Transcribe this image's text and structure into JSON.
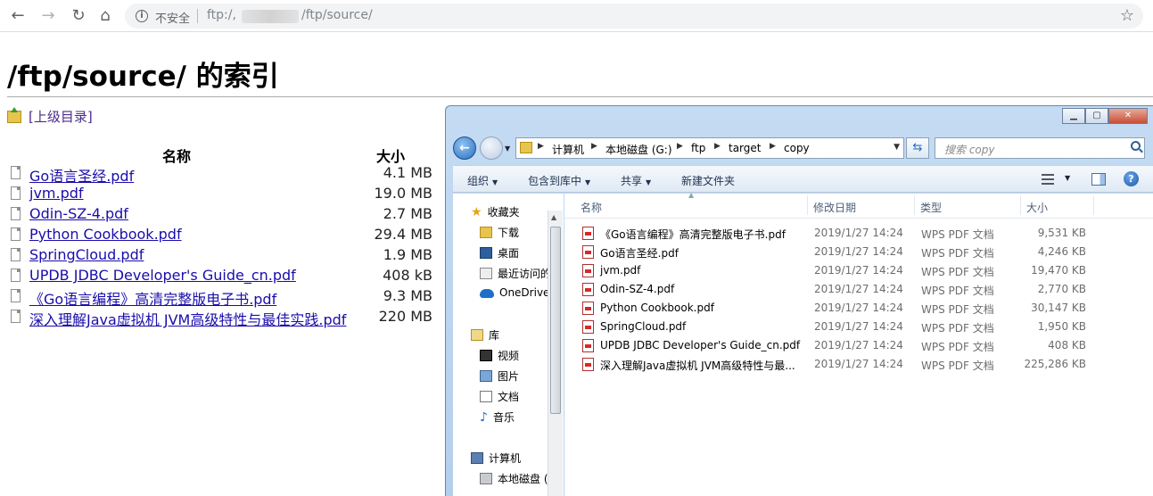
{
  "browser": {
    "security_label": "不安全",
    "url_prefix": "ftp:/,",
    "url_path": "/ftp/source/"
  },
  "page": {
    "title": "/ftp/source/ 的索引",
    "parent_link": "[上级目录]",
    "col_name": "名称",
    "col_size": "大小",
    "files": [
      {
        "name": "Go语言圣经.pdf",
        "size": "4.1 MB"
      },
      {
        "name": "jvm.pdf",
        "size": "19.0 MB"
      },
      {
        "name": "Odin-SZ-4.pdf",
        "size": "2.7 MB"
      },
      {
        "name": "Python Cookbook.pdf",
        "size": "29.4 MB"
      },
      {
        "name": "SpringCloud.pdf",
        "size": "1.9 MB"
      },
      {
        "name": "UPDB JDBC Developer's Guide_cn.pdf",
        "size": "408 kB"
      },
      {
        "name": "《Go语言编程》高清完整版电子书.pdf",
        "size": "9.3 MB"
      },
      {
        "name": "深入理解Java虚拟机 JVM高级特性与最佳实践.pdf",
        "size": "220 MB"
      }
    ]
  },
  "explorer": {
    "breadcrumbs": [
      "计算机",
      "本地磁盘 (G:)",
      "ftp",
      "target",
      "copy"
    ],
    "search_placeholder": "搜索 copy",
    "toolbar": {
      "organize": "组织",
      "include_library": "包含到库中",
      "share": "共享",
      "new_folder": "新建文件夹"
    },
    "nav": {
      "favorites": "收藏夹",
      "downloads": "下载",
      "desktop": "桌面",
      "recent": "最近访问的",
      "onedrive": "OneDrive",
      "libraries": "库",
      "videos": "视频",
      "pictures": "图片",
      "documents": "文档",
      "music": "音乐",
      "computer": "计算机",
      "local_disk": "本地磁盘 ("
    },
    "columns": {
      "name": "名称",
      "date": "修改日期",
      "type": "类型",
      "size": "大小"
    },
    "files": [
      {
        "name": "《Go语言编程》高清完整版电子书.pdf",
        "date": "2019/1/27 14:24",
        "type": "WPS PDF 文档",
        "size": "9,531 KB"
      },
      {
        "name": "Go语言圣经.pdf",
        "date": "2019/1/27 14:24",
        "type": "WPS PDF 文档",
        "size": "4,246 KB"
      },
      {
        "name": "jvm.pdf",
        "date": "2019/1/27 14:24",
        "type": "WPS PDF 文档",
        "size": "19,470 KB"
      },
      {
        "name": "Odin-SZ-4.pdf",
        "date": "2019/1/27 14:24",
        "type": "WPS PDF 文档",
        "size": "2,770 KB"
      },
      {
        "name": "Python Cookbook.pdf",
        "date": "2019/1/27 14:24",
        "type": "WPS PDF 文档",
        "size": "30,147 KB"
      },
      {
        "name": "SpringCloud.pdf",
        "date": "2019/1/27 14:24",
        "type": "WPS PDF 文档",
        "size": "1,950 KB"
      },
      {
        "name": "UPDB JDBC Developer's Guide_cn.pdf",
        "date": "2019/1/27 14:24",
        "type": "WPS PDF 文档",
        "size": "408 KB"
      },
      {
        "name": "深入理解Java虚拟机 JVM高级特性与最...",
        "date": "2019/1/27 14:24",
        "type": "WPS PDF 文档",
        "size": "225,286 KB"
      }
    ]
  }
}
